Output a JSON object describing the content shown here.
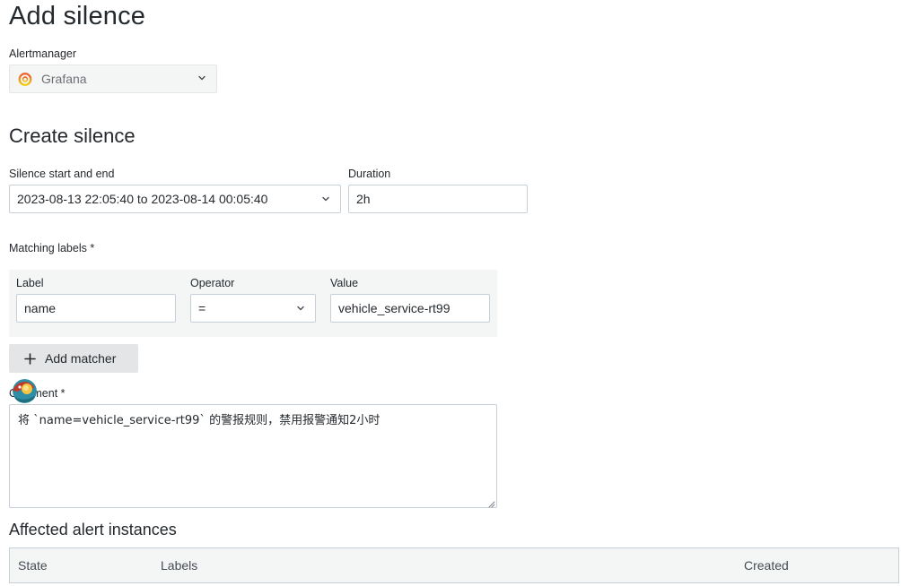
{
  "page": {
    "title": "Add silence"
  },
  "alertmanager": {
    "label": "Alertmanager",
    "selected": "Grafana",
    "logo_icon": "grafana-logo-icon"
  },
  "create": {
    "heading": "Create silence",
    "range_label": "Silence start and end",
    "range_value": "2023-08-13 22:05:40 to 2023-08-14 00:05:40",
    "duration_label": "Duration",
    "duration_value": "2h"
  },
  "matching": {
    "label": "Matching labels *",
    "columns": {
      "label": "Label",
      "operator": "Operator",
      "value": "Value"
    },
    "row": {
      "label": "name",
      "operator": "=",
      "value": "vehicle_service-rt99"
    },
    "add_button": "Add matcher"
  },
  "comment": {
    "label": "Comment *",
    "value": "将 `name=vehicle_service-rt99` 的警报规则，禁用报警通知2小时"
  },
  "affected": {
    "heading": "Affected alert instances",
    "columns": [
      "State",
      "Labels",
      "Created"
    ]
  },
  "colors": {
    "border": "#c7d0d9",
    "panel_bg": "#f4f5f5",
    "button_bg": "#e4e5e6",
    "text": "#24292e"
  }
}
